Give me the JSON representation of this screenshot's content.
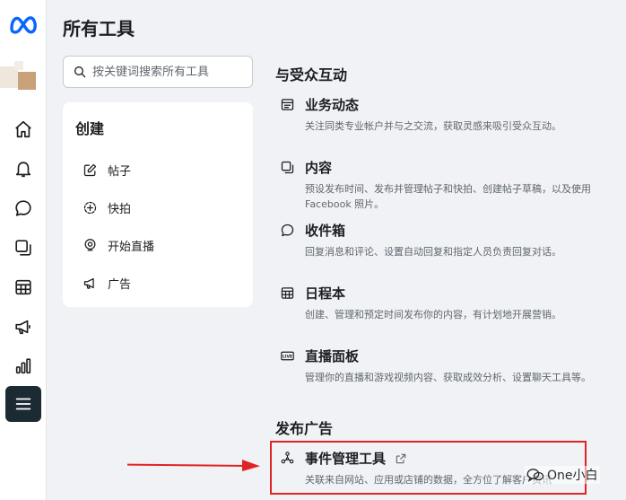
{
  "page": {
    "title": "所有工具"
  },
  "search": {
    "placeholder": "按关键词搜索所有工具"
  },
  "create": {
    "title": "创建",
    "items": [
      {
        "label": "帖子",
        "icon": "edit-icon"
      },
      {
        "label": "快拍",
        "icon": "story-add-icon"
      },
      {
        "label": "开始直播",
        "icon": "live-broadcast-icon"
      },
      {
        "label": "广告",
        "icon": "megaphone-icon"
      }
    ]
  },
  "sections": {
    "engage": "与受众互动",
    "ads": "发布广告"
  },
  "tools": [
    {
      "name": "业务动态",
      "icon": "feed-icon",
      "desc": "关注同类专业帐户并与之交流，获取灵感来吸引受众互动。"
    },
    {
      "name": "内容",
      "icon": "content-icon",
      "desc": "预设发布时间、发布并管理帖子和快拍、创建帖子草稿，以及使用 Facebook 照片。"
    },
    {
      "name": "收件箱",
      "icon": "inbox-chat-icon",
      "desc": "回复消息和评论、设置自动回复和指定人员负责回复对话。"
    },
    {
      "name": "日程本",
      "icon": "calendar-grid-icon",
      "desc": "创建、管理和预定时间发布你的内容，有计划地开展营销。"
    },
    {
      "name": "直播面板",
      "icon": "live-icon",
      "desc": "管理你的直播和游戏视频内容、获取成效分析、设置聊天工具等。"
    },
    {
      "name": "事件管理工具",
      "icon": "events-manager-icon",
      "desc": "关联来自网站、应用或店铺的数据，全方位了解客户资讯"
    }
  ],
  "watermark": {
    "text": "One小白"
  },
  "colors": {
    "highlight": "#e02424",
    "active_rail": "#1c2b33",
    "meta_blue": "#0866ff"
  }
}
